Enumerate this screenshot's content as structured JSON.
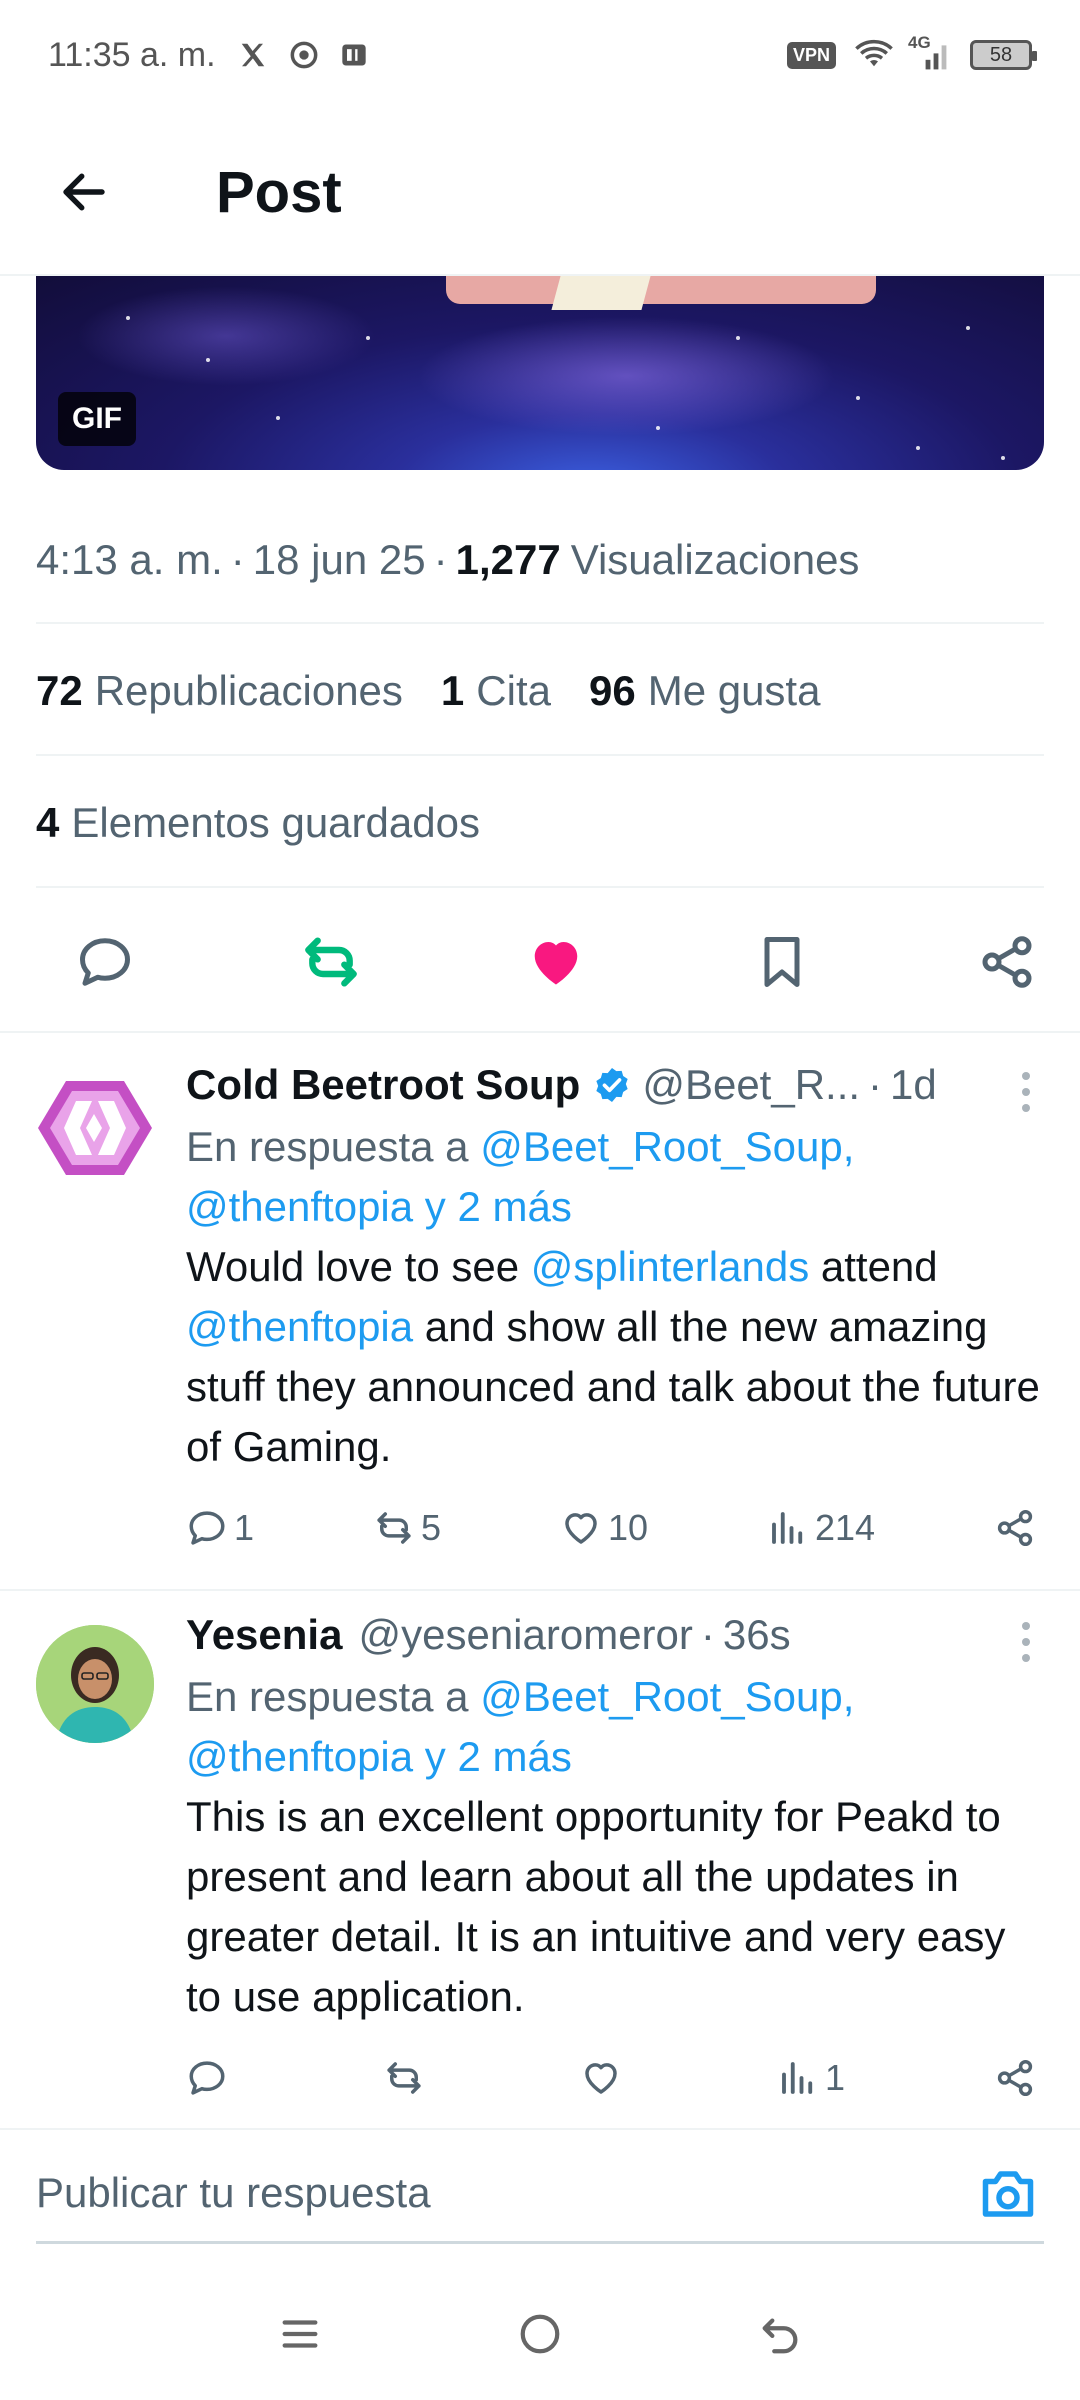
{
  "status_bar": {
    "time": "11:35 a. m.",
    "vpn": "VPN",
    "network": "4G",
    "battery": "58"
  },
  "header": {
    "title": "Post"
  },
  "media": {
    "badge": "GIF"
  },
  "post_meta": {
    "time": "4:13 a. m.",
    "sep1": "·",
    "date": "18 jun 25",
    "sep2": "·",
    "views_count": "1,277",
    "views_label": "Visualizaciones"
  },
  "stats": {
    "reposts_count": "72",
    "reposts_label": "Republicaciones",
    "quotes_count": "1",
    "quotes_label": "Cita",
    "likes_count": "96",
    "likes_label": "Me gusta",
    "saved_count": "4",
    "saved_label": "Elementos guardados"
  },
  "action_bar": {
    "icons": [
      "reply-icon",
      "repost-icon",
      "like-icon",
      "bookmark-icon",
      "share-icon"
    ],
    "repost_color": "#00ba7c",
    "like_color": "#f91880"
  },
  "replies": [
    {
      "name": "Cold Beetroot Soup",
      "verified": true,
      "handle": "@Beet_R...",
      "dot": "·",
      "age": "1d",
      "reply_to_prefix": "En respuesta a",
      "reply_to_user": "@Beet_Root_Soup,",
      "reply_to_more": "@thenftopia y 2 más",
      "text_parts": {
        "p1": "Would love to see ",
        "m1": "@splinterlands",
        "p2": " attend ",
        "m2": "@thenftopia",
        "p3": " and show all the new amazing stuff they announced and talk about the future of Gaming."
      },
      "replies_count": "1",
      "reposts_count": "5",
      "likes_count": "10",
      "views_count": "214"
    },
    {
      "name": "Yesenia",
      "verified": false,
      "handle": "@yeseniaromeror",
      "dot": "·",
      "age": "36s",
      "reply_to_prefix": "En respuesta a",
      "reply_to_user": "@Beet_Root_Soup,",
      "reply_to_more": "@thenftopia y 2 más",
      "text": "This is an excellent opportunity for Peakd to present and learn about all the updates in greater detail. It is an intuitive and very easy to use application.",
      "replies_count": "",
      "reposts_count": "",
      "likes_count": "",
      "views_count": "1"
    }
  ],
  "compose": {
    "placeholder": "Publicar tu respuesta"
  },
  "colors": {
    "link": "#1d9bf0",
    "text": "#0f1419",
    "secondary": "#536471"
  }
}
